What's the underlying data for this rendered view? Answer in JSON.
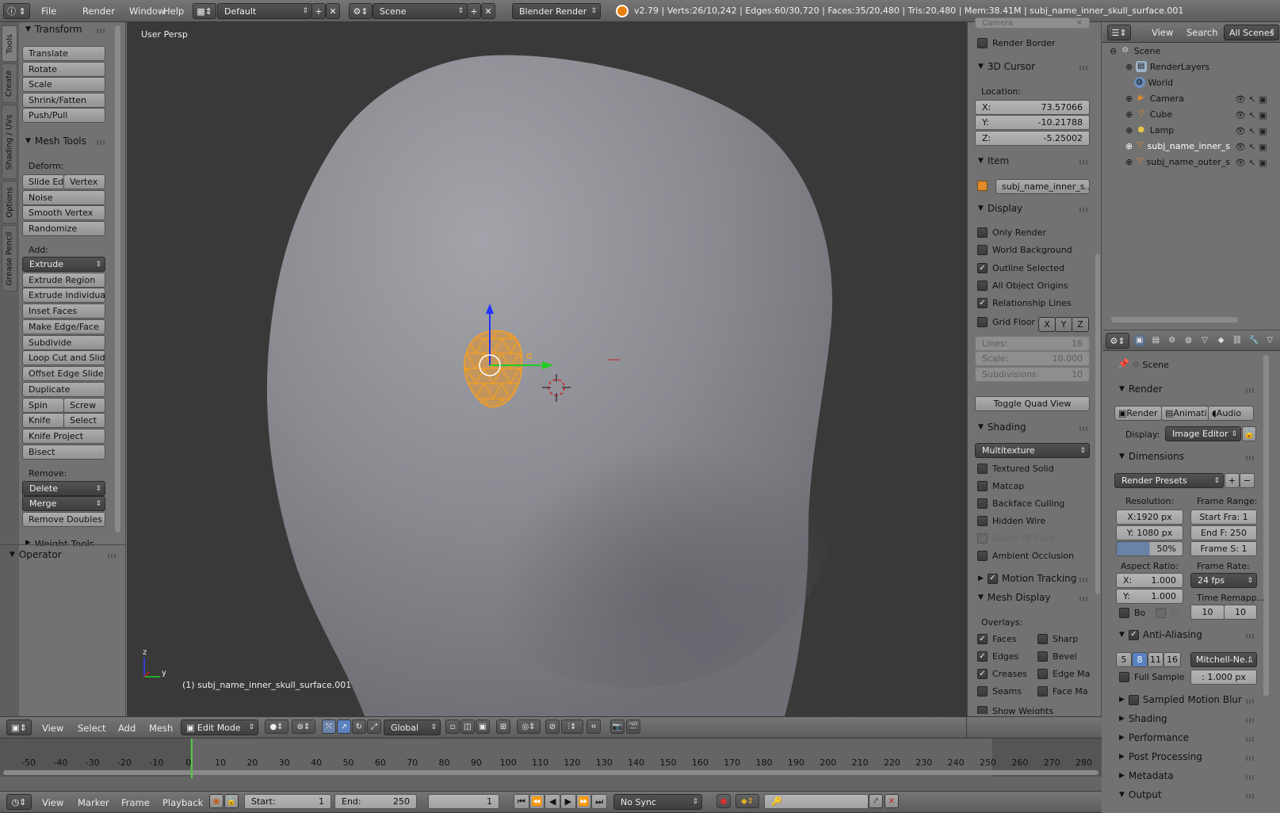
{
  "top_bar": {
    "menus": [
      "File",
      "Render",
      "Window",
      "Help"
    ],
    "layout": "Default",
    "scene": "Scene",
    "engine": "Blender Render",
    "stats": "v2.79 | Verts:26/10,242 | Edges:60/30,720 | Faces:35/20,480 | Tris:20,480 | Mem:38.41M | subj_name_inner_skull_surface.001"
  },
  "tool_tabs": [
    "Tools",
    "Create",
    "Shading / UVs",
    "Options",
    "Grease Pencil"
  ],
  "tools": {
    "transform_header": "Transform",
    "transform": [
      "Translate",
      "Rotate",
      "Scale",
      "Shrink/Fatten",
      "Push/Pull"
    ],
    "mesh_tools_header": "Mesh Tools",
    "deform_label": "Deform:",
    "slide_edge": "Slide Ed",
    "vertex": "Vertex",
    "deform": [
      "Noise",
      "Smooth Vertex",
      "Randomize"
    ],
    "add_label": "Add:",
    "extrude": "Extrude",
    "add": [
      "Extrude Region",
      "Extrude Individual",
      "Inset Faces",
      "Make Edge/Face",
      "Subdivide",
      "Loop Cut and Slide",
      "Offset Edge Slide",
      "Duplicate"
    ],
    "spin": "Spin",
    "screw": "Screw",
    "knife": "Knife",
    "select": "Select",
    "knife_project": "Knife Project",
    "bisect": "Bisect",
    "remove_label": "Remove:",
    "delete": "Delete",
    "merge": "Merge",
    "remove_doubles": "Remove Doubles",
    "weight_tools": "Weight Tools",
    "operator": "Operator"
  },
  "viewport": {
    "label": "User Persp",
    "object_label": "(1) subj_name_inner_skull_surface.001",
    "axis_z": "z",
    "axis_y": "y",
    "colors": {
      "background": "#393939",
      "mesh": "#8d8d94",
      "selection": "#f5a020"
    }
  },
  "properties": {
    "camera_label": "Camera",
    "render_border": "Render Border",
    "cursor_header": "3D Cursor",
    "location_label": "Location:",
    "x_label": "X:",
    "x_value": "73.57066",
    "y_label": "Y:",
    "y_value": "-10.21788",
    "z_label": "Z:",
    "z_value": "-5.25002",
    "item_header": "Item",
    "item_name": "subj_name_inner_s...",
    "display_header": "Display",
    "only_render": "Only Render",
    "world_background": "World Background",
    "outline_selected": "Outline Selected",
    "all_object_origins": "All Object Origins",
    "relationship_lines": "Relationship Lines",
    "grid_floor": "Grid Floor",
    "gx": "X",
    "gy": "Y",
    "gz": "Z",
    "lines_label": "Lines:",
    "lines_value": "16",
    "scale_label": "Scale:",
    "scale_value": "10.000",
    "subdiv_label": "Subdivisions:",
    "subdiv_value": "10",
    "toggle_quad": "Toggle Quad View",
    "shading_header": "Shading",
    "shading_mode": "Multitexture",
    "textured_solid": "Textured Solid",
    "matcap": "Matcap",
    "backface_culling": "Backface Culling",
    "hidden_wire": "Hidden Wire",
    "depth_of_field": "Depth Of Field",
    "ambient_occlusion": "Ambient Occlusion",
    "motion_tracking": "Motion Tracking",
    "mesh_display_header": "Mesh Display",
    "overlays_label": "Overlays:",
    "faces": "Faces",
    "sharp": "Sharp",
    "edges": "Edges",
    "bevel": "Bevel",
    "creases": "Creases",
    "edge_ma": "Edge Ma",
    "seams": "Seams",
    "face_ma": "Face Ma",
    "show_weights": "Show Weights"
  },
  "outliner": {
    "view": "View",
    "search": "Search",
    "all_scenes": "All Scenes",
    "items": [
      "Scene",
      "RenderLayers",
      "World",
      "Camera",
      "Cube",
      "Lamp",
      "subj_name_inner_s",
      "subj_name_outer_s"
    ]
  },
  "render_props": {
    "scene": "Scene",
    "render_header": "Render",
    "render_btn": "Render",
    "anim_btn": "Animati",
    "audio_btn": "Audio",
    "display_label": "Display:",
    "display_value": "Image Editor",
    "dimensions_header": "Dimensions",
    "presets": "Render Presets",
    "resolution_label": "Resolution:",
    "frame_range_label": "Frame Range:",
    "res_x": "X:1920 px",
    "res_y": "Y: 1080 px",
    "res_pct": "50%",
    "start_frame": "Start Fra: 1",
    "end_frame": "End F: 250",
    "frame_step": "Frame S: 1",
    "aspect_label": "Aspect Ratio:",
    "frame_rate_label": "Frame Rate:",
    "asp_x_label": "X:",
    "asp_x": "1.000",
    "asp_y_label": "Y:",
    "asp_y": "1.000",
    "fps": "24 fps",
    "time_remap": "Time Remapp...",
    "bo": "Bo",
    "cr": "Cr",
    "remap_old": "10",
    "remap_new": "10",
    "aa_header": "Anti-Aliasing",
    "aa_samples": [
      "5",
      "8",
      "11",
      "16"
    ],
    "aa_filter": "Mitchell-Ne...",
    "full_sample": "Full Sample",
    "filter_size": ": 1.000 px",
    "sampled_motion_blur": "Sampled Motion Blur",
    "shading": "Shading",
    "performance": "Performance",
    "post_processing": "Post Processing",
    "metadata": "Metadata",
    "output": "Output"
  },
  "view3d_header": {
    "view": "View",
    "select": "Select",
    "add": "Add",
    "mesh": "Mesh",
    "mode": "Edit Mode",
    "orientation": "Global"
  },
  "timeline": {
    "ticks": [
      "-50",
      "-40",
      "-30",
      "-20",
      "-10",
      "0",
      "10",
      "20",
      "30",
      "40",
      "50",
      "60",
      "70",
      "80",
      "90",
      "100",
      "110",
      "120",
      "130",
      "140",
      "150",
      "160",
      "170",
      "180",
      "190",
      "200",
      "210",
      "220",
      "230",
      "240",
      "250",
      "260",
      "270",
      "280"
    ],
    "current_frame": 1,
    "view": "View",
    "marker": "Marker",
    "frame": "Frame",
    "playback": "Playback",
    "start_label": "Start:",
    "start": "1",
    "end_label": "End:",
    "end": "250",
    "current": "1",
    "sync": "No Sync"
  }
}
